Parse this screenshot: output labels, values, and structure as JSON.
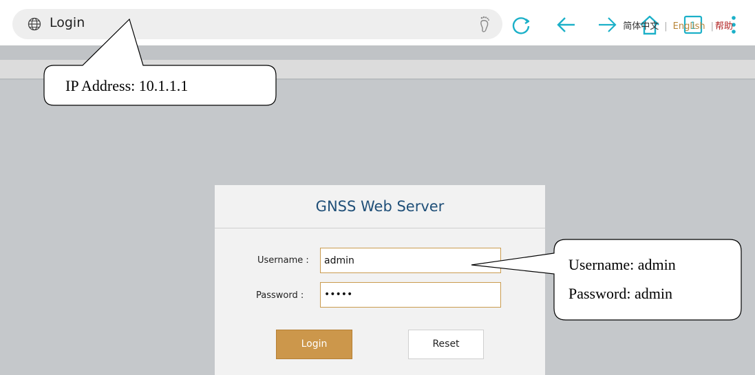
{
  "browser": {
    "url_title": "Login",
    "tab_count": "1",
    "icons": [
      "globe-icon",
      "footprint-icon",
      "refresh-icon",
      "back-arrow-icon",
      "forward-arrow-icon",
      "home-icon",
      "tabs-icon",
      "more-vert-icon"
    ],
    "accent": "#1bb0c8"
  },
  "lang_bar": {
    "chinese": "简体中文",
    "english": "English",
    "help": "帮助",
    "separator": "|"
  },
  "login": {
    "title": "GNSS Web Server",
    "username_label": "Username :",
    "username_value": "admin",
    "password_label": "Password :",
    "password_value": "•••••",
    "login_button": "Login",
    "reset_button": "Reset",
    "accent": "#cc974b"
  },
  "callouts": {
    "ip_address": "IP Address: 10.1.1.1",
    "username_note": "Username: admin",
    "password_note": "Password: admin"
  }
}
